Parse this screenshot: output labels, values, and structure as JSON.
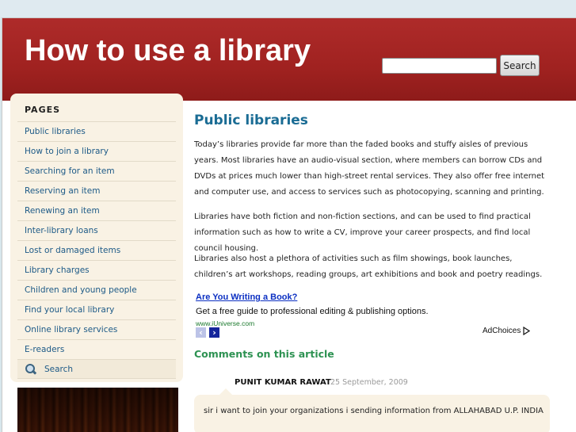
{
  "header": {
    "site_title": "How to use a library",
    "search_button_label": "Search",
    "search_value": ""
  },
  "sidebar": {
    "heading": "PAGES",
    "items": [
      {
        "label": "Public libraries"
      },
      {
        "label": "How to join a library"
      },
      {
        "label": "Searching for an item"
      },
      {
        "label": "Reserving an item"
      },
      {
        "label": "Renewing an item"
      },
      {
        "label": "Inter-library loans"
      },
      {
        "label": "Lost or damaged items"
      },
      {
        "label": "Library charges"
      },
      {
        "label": "Children and young people"
      },
      {
        "label": "Find your local library"
      },
      {
        "label": "Online library services"
      },
      {
        "label": "E-readers"
      }
    ],
    "search_label": "Search"
  },
  "article": {
    "title": "Public libraries",
    "paragraphs": [
      "Today’s libraries provide far more than the faded books and stuffy aisles of previous years.  Most libraries have an audio-visual section, where members can borrow CDs and DVDs at prices much lower than high-street rental services.  They also offer free internet and computer use, and access to services such as photocopying, scanning and printing.",
      "Libraries have both fiction and non-fiction sections, and can be used to find practical information such as how to write a CV, improve your career prospects, and find local council housing.",
      "Libraries also host a plethora of activities such as film showings, book launches, children’s art workshops, reading groups, art exhibitions and book and poetry readings."
    ]
  },
  "ad": {
    "link_text": "Are You Writing a Book?",
    "description": "Get a free guide to professional editing & publishing options.",
    "url": "www.iUniverse.com",
    "prev_glyph": "‹",
    "next_glyph": "›",
    "adchoices_label": "AdChoices"
  },
  "comments": {
    "heading": "Comments on this article",
    "items": [
      {
        "author": "PUNIT KUMAR RAWAT",
        "date": "25 September, 2009",
        "text": "sir i want to join your organizations i sending information from ALLAHABAD U.P. INDIA"
      }
    ]
  },
  "colors": {
    "header_red": "#a02220",
    "link_blue": "#1d5a87",
    "title_blue": "#1a6c94",
    "comments_green": "#2d9252",
    "sidebar_beige": "#f9f2e4"
  }
}
